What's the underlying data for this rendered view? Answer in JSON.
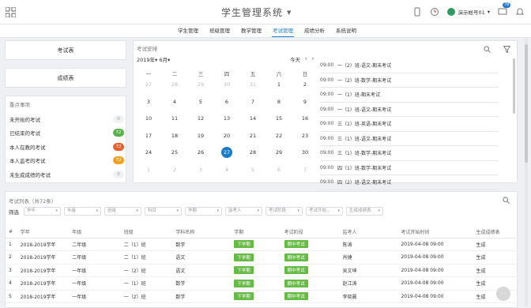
{
  "header": {
    "title": "学生管理系统",
    "user": "演示帐号01",
    "badge": "78"
  },
  "nav": [
    "学生管理",
    "班级管理",
    "教学管理",
    "考试管理",
    "成绩分析",
    "系统说明"
  ],
  "nav_active": 3,
  "side": {
    "btn1": "考试表",
    "btn2": "成绩表",
    "reminder_title": "重点事项",
    "items": [
      {
        "label": "未开始的考试",
        "count": "0",
        "color": "#f0f1f3"
      },
      {
        "label": "已结束的考试",
        "count": "72",
        "color": "#55b34a"
      },
      {
        "label": "本人在教的考试",
        "count": "72",
        "color": "#e8602c"
      },
      {
        "label": "本人监考的考试",
        "count": "72",
        "color": "#f0a11e"
      },
      {
        "label": "未生成成绩的考试",
        "count": "0",
        "color": "#f0f1f3"
      }
    ]
  },
  "calendar": {
    "title": "考试安排",
    "year": "2019年",
    "month": "6月",
    "today": "今天",
    "weekdays": [
      "一",
      "二",
      "三",
      "四",
      "五",
      "六",
      "日"
    ],
    "weeks": [
      [
        "27",
        "28",
        "29",
        "30",
        "31",
        "1",
        "2"
      ],
      [
        "3",
        "4",
        "5",
        "6",
        "7",
        "8",
        "9"
      ],
      [
        "10",
        "11",
        "12",
        "13",
        "14",
        "15",
        "16"
      ],
      [
        "17",
        "18",
        "19",
        "20",
        "21",
        "22",
        "23"
      ],
      [
        "24",
        "25",
        "26",
        "27",
        "28",
        "29",
        "30"
      ],
      [
        "1",
        "2",
        "3",
        "4",
        "5",
        "6",
        "7"
      ]
    ],
    "events": [
      {
        "time": "09:00",
        "name": "一（2）班-语文-期末考试"
      },
      {
        "time": "09:00",
        "name": "一（2）班-数学-期末考试"
      },
      {
        "time": "09:00",
        "name": "一（1）班-期末考试"
      },
      {
        "time": "09:00",
        "name": "一（1）班-语文-期末考试"
      },
      {
        "time": "09:00",
        "name": "三（1）班-英语-期末考试"
      },
      {
        "time": "09:00",
        "name": "三（1）班-语文-期末考试"
      },
      {
        "time": "09:00",
        "name": "三（1）班-数学-期末考试"
      },
      {
        "time": "09:00",
        "name": "四（1）班-数学-期末考试"
      },
      {
        "time": "09:00",
        "name": "四（2）班-语文-期末考试"
      }
    ]
  },
  "list": {
    "title": "考试列表（共72条）",
    "filter_label": "筛选",
    "filters": [
      "学年",
      "年级",
      "班级",
      "科目",
      "学期",
      "监考人",
      "考试阶段",
      "考试开始...",
      "生成成绩表"
    ],
    "columns": [
      "#",
      "学年",
      "年级",
      "班级",
      "学科名称",
      "学期",
      "考试阶段",
      "监考人",
      "考试开始时间",
      "生成成绩表"
    ],
    "rows": [
      [
        "1",
        "2018-2019学年",
        "二年级",
        "二（1）班",
        "数学",
        "下学期",
        "期中考试",
        "陈涛",
        "2019-04-08 09:00",
        "生成"
      ],
      [
        "2",
        "2018-2019学年",
        "二年级",
        "二（1）班",
        "语文",
        "下学期",
        "期中考试",
        "肖捷",
        "2019-04-08 09:00",
        "生成"
      ],
      [
        "3",
        "2018-2019学年",
        "一年级",
        "一（2）班",
        "语文",
        "下学期",
        "期中考试",
        "吴文坤",
        "2019-04-08 09:00",
        "生成"
      ],
      [
        "4",
        "2018-2019学年",
        "一年级",
        "一（1）班",
        "数学",
        "下学期",
        "期中考试",
        "赵江涛",
        "2019-04-08 09:00",
        "生成"
      ],
      [
        "5",
        "2018-2019学年",
        "一年级",
        "一（2）班",
        "数学",
        "下学期",
        "期中考试",
        "李晓晨",
        "2019-04-08 09:00",
        "生成"
      ]
    ]
  }
}
